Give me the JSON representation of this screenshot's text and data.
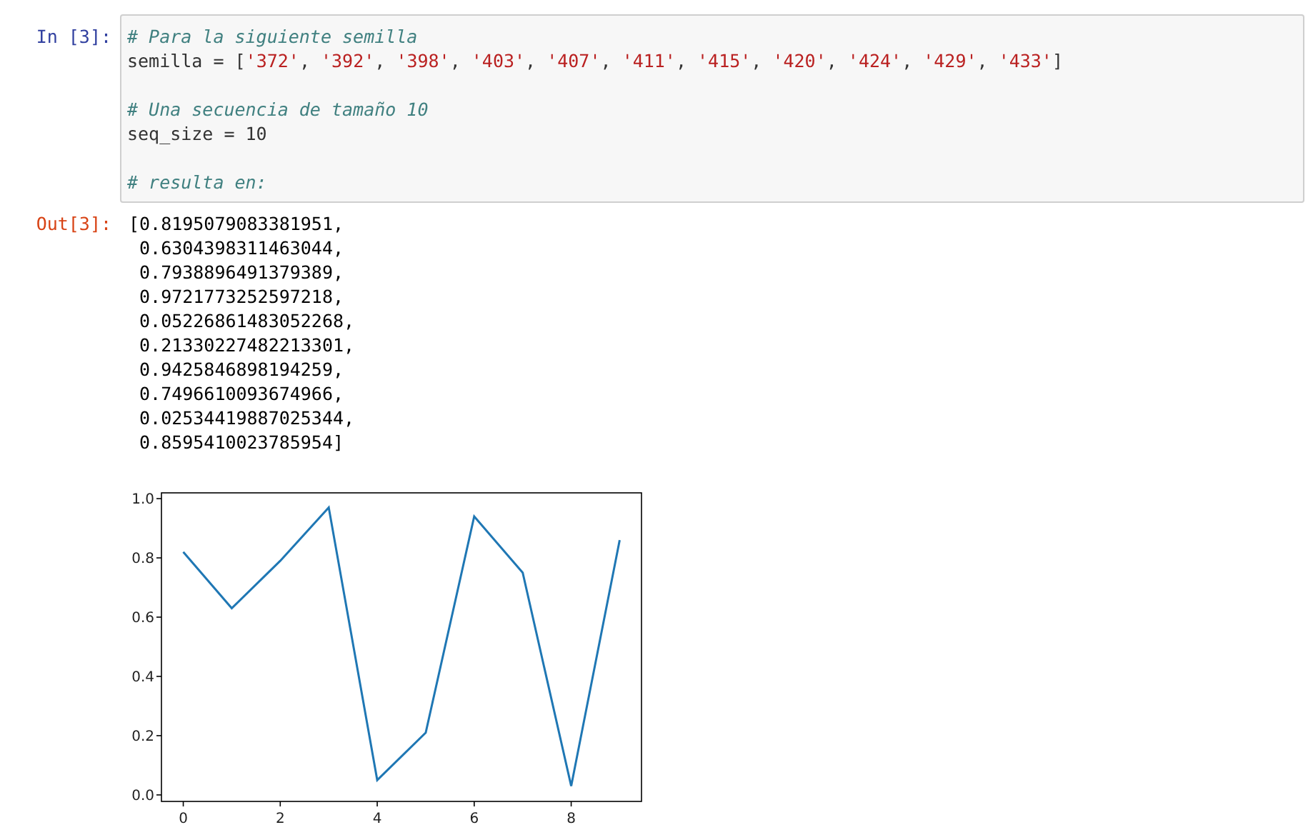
{
  "input_cell": {
    "prompt": "In [3]:",
    "lines": [
      {
        "kind": "comment",
        "tokens": [
          {
            "kind": "comment",
            "text": "# Para la siguiente semilla"
          }
        ]
      },
      {
        "kind": "code",
        "tokens": [
          {
            "kind": "plain",
            "text": "semilla = ["
          },
          {
            "kind": "string",
            "text": "'372'"
          },
          {
            "kind": "plain",
            "text": ", "
          },
          {
            "kind": "string",
            "text": "'392'"
          },
          {
            "kind": "plain",
            "text": ", "
          },
          {
            "kind": "string",
            "text": "'398'"
          },
          {
            "kind": "plain",
            "text": ", "
          },
          {
            "kind": "string",
            "text": "'403'"
          },
          {
            "kind": "plain",
            "text": ", "
          },
          {
            "kind": "string",
            "text": "'407'"
          },
          {
            "kind": "plain",
            "text": ", "
          },
          {
            "kind": "string",
            "text": "'411'"
          },
          {
            "kind": "plain",
            "text": ", "
          },
          {
            "kind": "string",
            "text": "'415'"
          },
          {
            "kind": "plain",
            "text": ", "
          },
          {
            "kind": "string",
            "text": "'420'"
          },
          {
            "kind": "plain",
            "text": ", "
          },
          {
            "kind": "string",
            "text": "'424'"
          },
          {
            "kind": "plain",
            "text": ", "
          },
          {
            "kind": "string",
            "text": "'429'"
          },
          {
            "kind": "plain",
            "text": ", "
          },
          {
            "kind": "string",
            "text": "'433'"
          },
          {
            "kind": "plain",
            "text": "]"
          }
        ]
      },
      {
        "kind": "blank"
      },
      {
        "kind": "comment",
        "tokens": [
          {
            "kind": "comment",
            "text": "# Una secuencia de tamaño 10"
          }
        ]
      },
      {
        "kind": "code",
        "tokens": [
          {
            "kind": "plain",
            "text": "seq_size = 10"
          }
        ]
      },
      {
        "kind": "blank"
      },
      {
        "kind": "comment",
        "tokens": [
          {
            "kind": "comment",
            "text": "# resulta en:"
          }
        ]
      }
    ]
  },
  "output_cell": {
    "prompt": "Out[3]:",
    "lines": [
      "[0.8195079083381951,",
      " 0.6304398311463044,",
      " 0.7938896491379389,",
      " 0.9721773252597218,",
      " 0.05226861483052268,",
      " 0.21330227482213301,",
      " 0.9425846898194259,",
      " 0.7496610093674966,",
      " 0.02534419887025344,",
      " 0.8595410023785954]"
    ],
    "chart_data": {
      "type": "line",
      "x": [
        0,
        1,
        2,
        3,
        4,
        5,
        6,
        7,
        8,
        9
      ],
      "series": [
        {
          "color": "#1f77b4",
          "values": [
            0.82,
            0.63,
            0.79,
            0.97,
            0.05,
            0.21,
            0.94,
            0.75,
            0.03,
            0.86
          ]
        }
      ],
      "xlim": [
        -0.45,
        9.45
      ],
      "ylim": [
        -0.022,
        1.0195
      ],
      "xticks": [
        0,
        2,
        4,
        6,
        8
      ],
      "yticks": [
        {
          "value": 0,
          "label": "0.0"
        },
        {
          "value": 0.2,
          "label": "0.2"
        },
        {
          "value": 0.4,
          "label": "0.4"
        },
        {
          "value": 0.6,
          "label": "0.6"
        },
        {
          "value": 0.8,
          "label": "0.8"
        },
        {
          "value": 1,
          "label": "1.0"
        }
      ]
    }
  }
}
